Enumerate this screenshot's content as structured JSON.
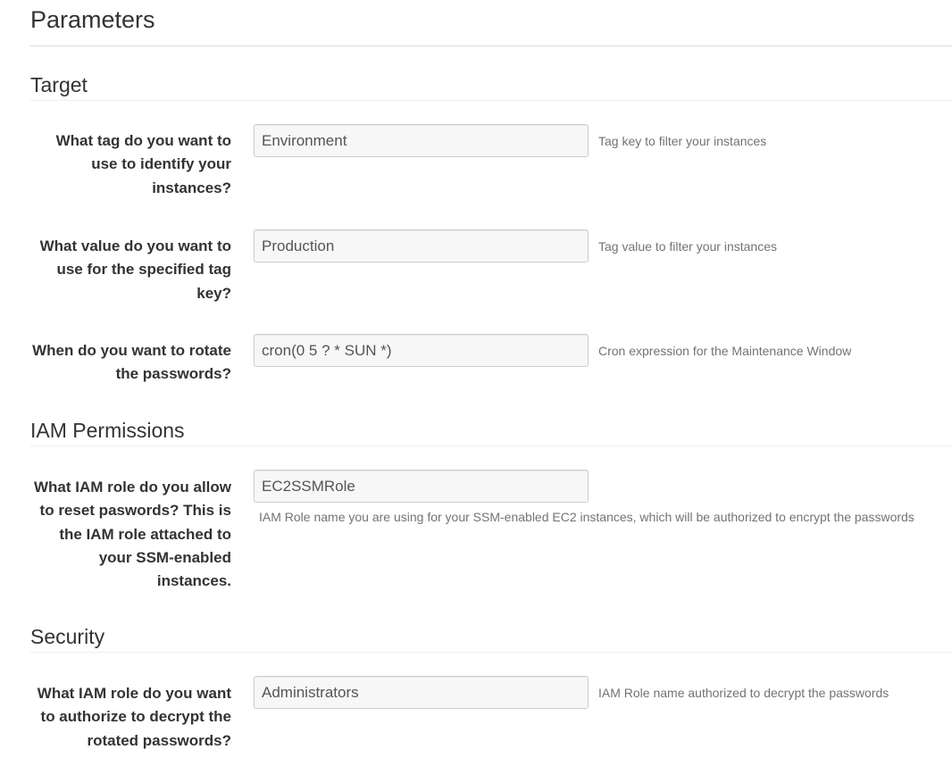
{
  "page": {
    "title": "Parameters"
  },
  "sections": [
    {
      "title": "Target",
      "fields": [
        {
          "label": "What tag do you want to use to identify your instances?",
          "value": "Environment",
          "help": "Tag key to filter your instances"
        },
        {
          "label": "What value do you want to use for the specified tag key?",
          "value": "Production",
          "help": "Tag value to filter your instances"
        },
        {
          "label": "When do you want to rotate the passwords?",
          "value": "cron(0 5 ? * SUN *)",
          "help": "Cron expression for the Maintenance Window"
        }
      ]
    },
    {
      "title": "IAM Permissions",
      "fields": [
        {
          "label": "What IAM role do you allow to reset paswords? This is the IAM role attached to your SSM-enabled instances.",
          "value": "EC2SSMRole",
          "help": "IAM Role name you are using for your SSM-enabled EC2 instances, which will be authorized to encrypt the passwords"
        }
      ]
    },
    {
      "title": "Security",
      "fields": [
        {
          "label": "What IAM role do you want to authorize to decrypt the rotated passwords?",
          "value": "Administrators",
          "help": "IAM Role name authorized to decrypt the passwords"
        }
      ]
    }
  ]
}
